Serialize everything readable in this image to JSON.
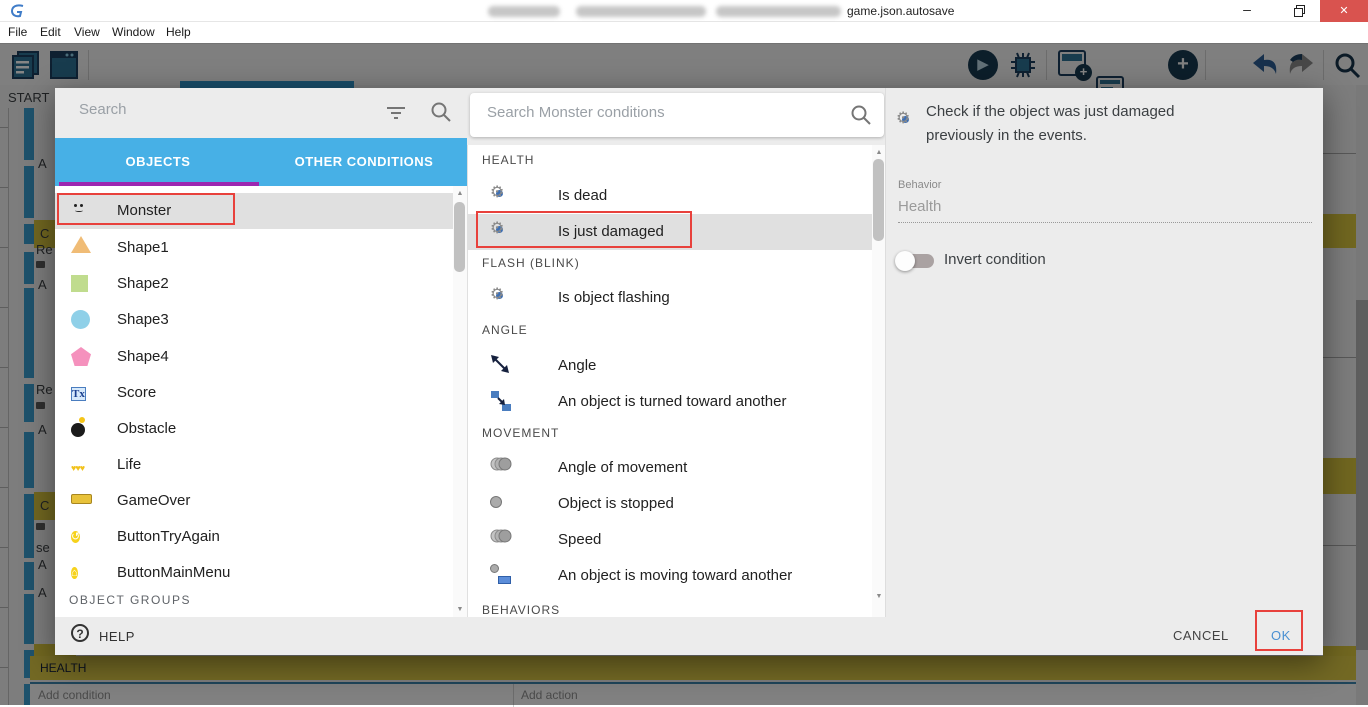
{
  "window": {
    "title_visible": "game.json.autosave",
    "minimize_glyph": "–",
    "close_glyph": "✕"
  },
  "menu": {
    "items": [
      "File",
      "Edit",
      "View",
      "Window",
      "Help"
    ]
  },
  "background": {
    "scene_tab": "START",
    "fragments": {
      "f1": "A",
      "c1": "C",
      "f2": "Re",
      "f3": "A",
      "f4": "Re",
      "f5": "A",
      "c2": "C",
      "f6": "se",
      "f7": "A",
      "f8": "A"
    },
    "group_bar": "HEALTH",
    "add_condition": "Add condition",
    "add_action": "Add action"
  },
  "dialog": {
    "left": {
      "search_placeholder": "Search",
      "tabs": [
        {
          "label": "OBJECTS",
          "active": true
        },
        {
          "label": "OTHER CONDITIONS",
          "active": false
        }
      ],
      "objects": [
        {
          "label": "Monster",
          "selected": true,
          "highlighted": true
        },
        {
          "label": "Shape1"
        },
        {
          "label": "Shape2"
        },
        {
          "label": "Shape3"
        },
        {
          "label": "Shape4"
        },
        {
          "label": "Score"
        },
        {
          "label": "Obstacle"
        },
        {
          "label": "Life"
        },
        {
          "label": "GameOver"
        },
        {
          "label": "ButtonTryAgain"
        },
        {
          "label": "ButtonMainMenu"
        }
      ],
      "groups_header": "OBJECT GROUPS"
    },
    "middle": {
      "search_placeholder": "Search Monster conditions",
      "items": [
        {
          "type": "header",
          "label": "HEALTH"
        },
        {
          "type": "item",
          "label": "Is dead",
          "icon": "gear-icon"
        },
        {
          "type": "item",
          "label": "Is just damaged",
          "icon": "gear-icon",
          "selected": true,
          "highlighted": true
        },
        {
          "type": "header",
          "label": "FLASH (BLINK)"
        },
        {
          "type": "item",
          "label": "Is object flashing",
          "icon": "gear-icon"
        },
        {
          "type": "header",
          "label": "ANGLE"
        },
        {
          "type": "item",
          "label": "Angle",
          "icon": "angle-arrow-icon"
        },
        {
          "type": "item",
          "label": "An object is turned toward another",
          "icon": "turned-toward-icon"
        },
        {
          "type": "header",
          "label": "MOVEMENT"
        },
        {
          "type": "item",
          "label": "Angle of movement",
          "icon": "circles-icon"
        },
        {
          "type": "item",
          "label": "Object is stopped",
          "icon": "circle-icon"
        },
        {
          "type": "item",
          "label": "Speed",
          "icon": "circles-icon"
        },
        {
          "type": "item",
          "label": "An object is moving toward another",
          "icon": "moving-toward-icon"
        },
        {
          "type": "header",
          "label": "BEHAVIORS"
        }
      ]
    },
    "right": {
      "description": "Check if the object was just damaged previously in the events.",
      "behavior_label": "Behavior",
      "behavior_value": "Health",
      "invert_label": "Invert condition",
      "invert_on": false
    },
    "footer": {
      "help": "HELP",
      "cancel": "CANCEL",
      "ok": "OK"
    }
  },
  "icons": {
    "gear": "⚙",
    "hearts": "♥♥♥",
    "retry": "↺",
    "home": "⌂",
    "score": "Tx",
    "play": "▶",
    "question": "?",
    "up": "▲",
    "down": "▼",
    "plus": "+",
    "minus": "−"
  },
  "colors": {
    "accent_blue": "#47b0e6",
    "tab_underline": "#9c27b0",
    "highlight_red": "#e8413c",
    "ok_blue": "#4a90d2",
    "selected_row": "#e0e0e0",
    "group_yellow": "#d9c63f",
    "event_blue": "#3a9ecf",
    "close_red": "#d9534f"
  }
}
